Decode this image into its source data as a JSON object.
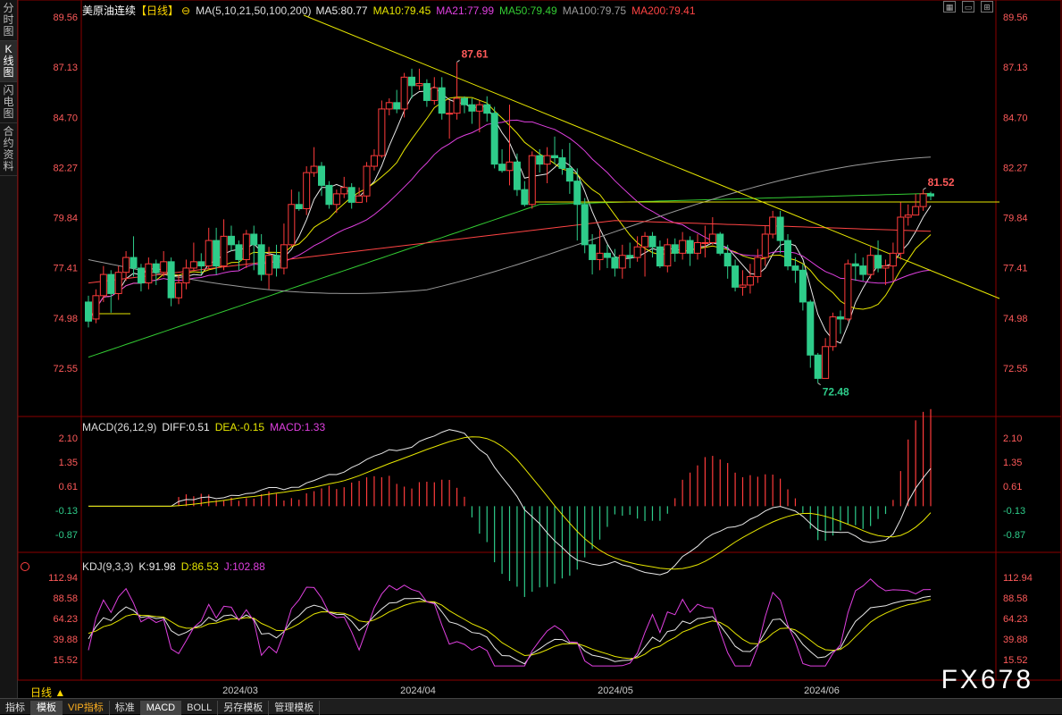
{
  "side_tabs": [
    {
      "label": "分时图",
      "active": false
    },
    {
      "label": "K线图",
      "active": true
    },
    {
      "label": "闪电图",
      "active": false
    },
    {
      "label": "合约资料",
      "active": false
    }
  ],
  "header": {
    "symbol": "美原油连续",
    "period": "【日线】",
    "ma_params": "MA(5,10,21,50,100,200)",
    "ma_items": [
      {
        "text": "MA5:80.77",
        "color": "#e8e8e8"
      },
      {
        "text": "MA10:79.45",
        "color": "#e6e600"
      },
      {
        "text": "MA21:77.99",
        "color": "#e040e0"
      },
      {
        "text": "MA50:79.49",
        "color": "#33cc33"
      },
      {
        "text": "MA100:79.75",
        "color": "#9a9a9a"
      },
      {
        "text": "MA200:79.41",
        "color": "#ff4444"
      }
    ]
  },
  "macd_header": {
    "params": "MACD(26,12,9)",
    "diff": "DIFF:0.51",
    "dea": "DEA:-0.15",
    "macd": "MACD:1.33"
  },
  "kdj_header": {
    "params": "KDJ(9,3,3)",
    "k": "K:91.98",
    "d": "D:86.53",
    "j": "J:102.88"
  },
  "price_axis": [
    "89.56",
    "87.13",
    "84.70",
    "82.27",
    "79.84",
    "77.41",
    "74.98",
    "72.55"
  ],
  "macd_axis": [
    "2.10",
    "1.35",
    "0.61",
    "-0.13",
    "-0.87"
  ],
  "kdj_axis": [
    "112.94",
    "88.58",
    "64.23",
    "39.88",
    "15.52"
  ],
  "date_axis": [
    "2024/03",
    "2024/04",
    "2024/05",
    "2024/06"
  ],
  "annotations": {
    "high": "87.61",
    "low": "72.48",
    "last": "81.52"
  },
  "period_button": "日线 ▲",
  "footer_tabs": [
    {
      "label": "指标",
      "active": false
    },
    {
      "label": "模板",
      "active": true
    },
    {
      "label": "VIP指标",
      "active": false
    },
    {
      "label": "标准",
      "active": false
    },
    {
      "label": "MACD",
      "active": true
    },
    {
      "label": "BOLL",
      "active": false
    },
    {
      "label": "另存模板",
      "active": false
    },
    {
      "label": "管理模板",
      "active": false
    }
  ],
  "watermark": "FX678",
  "colors": {
    "up": "#ff3b3b",
    "down": "#2ecc8a",
    "text_up": "#ff5a5a",
    "text_down": "#2ecc8a",
    "grid": "#1a1a1a"
  },
  "chart_data": {
    "type": "candlestick",
    "ylim": [
      72.0,
      90.2
    ],
    "candles": [
      [
        76.3,
        75.4,
        76.6,
        75.1
      ],
      [
        75.5,
        76.6,
        76.9,
        75.3
      ],
      [
        76.6,
        77.6,
        78.0,
        76.3
      ],
      [
        77.6,
        76.7,
        77.8,
        75.8
      ],
      [
        76.7,
        77.7,
        78.0,
        76.4
      ],
      [
        77.7,
        78.4,
        78.7,
        77.3
      ],
      [
        78.4,
        77.9,
        79.4,
        77.5
      ],
      [
        77.9,
        77.2,
        78.1,
        76.8
      ],
      [
        77.2,
        78.1,
        78.4,
        76.9
      ],
      [
        78.1,
        77.7,
        78.3,
        77.1
      ],
      [
        77.7,
        78.2,
        78.7,
        77.5
      ],
      [
        78.2,
        76.5,
        78.4,
        76.1
      ],
      [
        76.5,
        77.2,
        77.6,
        76.2
      ],
      [
        77.2,
        77.9,
        78.3,
        76.9
      ],
      [
        77.9,
        78.2,
        79.1,
        77.8
      ],
      [
        78.2,
        78.0,
        78.6,
        77.6
      ],
      [
        78.0,
        79.2,
        79.8,
        77.9
      ],
      [
        79.2,
        78.0,
        79.8,
        77.6
      ],
      [
        78.0,
        79.4,
        80.2,
        77.8
      ],
      [
        79.4,
        79.0,
        79.9,
        78.7
      ],
      [
        79.0,
        78.3,
        79.2,
        77.8
      ],
      [
        78.3,
        79.5,
        79.7,
        77.9
      ],
      [
        79.5,
        79.0,
        79.9,
        77.8
      ],
      [
        79.0,
        77.6,
        79.5,
        77.3
      ],
      [
        77.6,
        78.5,
        78.9,
        76.9
      ],
      [
        78.5,
        77.9,
        79.0,
        77.5
      ],
      [
        77.9,
        79.0,
        80.0,
        77.6
      ],
      [
        79.0,
        80.9,
        81.6,
        78.9
      ],
      [
        80.9,
        80.7,
        81.5,
        80.6
      ],
      [
        80.7,
        82.4,
        82.7,
        80.4
      ],
      [
        82.4,
        82.7,
        83.6,
        82.2
      ],
      [
        82.7,
        81.8,
        82.9,
        81.3
      ],
      [
        81.8,
        80.9,
        82.0,
        80.7
      ],
      [
        80.9,
        81.4,
        81.6,
        80.5
      ],
      [
        81.4,
        81.7,
        82.2,
        81.2
      ],
      [
        81.7,
        81.0,
        81.9,
        80.7
      ],
      [
        81.0,
        81.3,
        81.7,
        81.0
      ],
      [
        81.3,
        82.7,
        82.9,
        81.0
      ],
      [
        82.7,
        83.2,
        83.5,
        82.5
      ],
      [
        83.2,
        85.4,
        85.8,
        83.1
      ],
      [
        85.4,
        85.7,
        85.9,
        85.1
      ],
      [
        85.7,
        85.4,
        86.3,
        85.2
      ],
      [
        85.4,
        86.9,
        87.1,
        85.0
      ],
      [
        86.9,
        86.5,
        87.3,
        85.9
      ],
      [
        86.5,
        86.6,
        87.3,
        86.3
      ],
      [
        86.6,
        85.8,
        86.8,
        85.5
      ],
      [
        85.8,
        86.4,
        86.9,
        85.6
      ],
      [
        86.4,
        85.2,
        86.9,
        84.9
      ],
      [
        85.2,
        85.2,
        85.8,
        84.0
      ],
      [
        85.2,
        85.9,
        87.6,
        84.9
      ],
      [
        85.9,
        85.6,
        86.0,
        85.2
      ],
      [
        85.6,
        85.3,
        85.9,
        84.7
      ],
      [
        85.3,
        85.6,
        85.8,
        84.3
      ],
      [
        85.6,
        85.2,
        86.0,
        84.8
      ],
      [
        85.2,
        82.8,
        85.5,
        82.6
      ],
      [
        82.8,
        82.5,
        83.5,
        82.4
      ],
      [
        82.5,
        82.9,
        85.6,
        81.8
      ],
      [
        82.9,
        81.6,
        83.3,
        81.3
      ],
      [
        81.6,
        80.9,
        82.0,
        80.8
      ],
      [
        80.9,
        83.2,
        83.4,
        80.7
      ],
      [
        83.2,
        82.8,
        83.5,
        82.4
      ],
      [
        82.8,
        83.2,
        83.6,
        81.9
      ],
      [
        83.2,
        83.1,
        84.1,
        82.8
      ],
      [
        83.1,
        82.6,
        83.5,
        82.3
      ],
      [
        82.6,
        82.0,
        83.8,
        81.4
      ],
      [
        82.0,
        80.9,
        82.6,
        79.2
      ],
      [
        80.9,
        79.0,
        81.2,
        78.6
      ],
      [
        79.0,
        78.3,
        79.5,
        77.6
      ],
      [
        78.3,
        78.6,
        79.7,
        77.8
      ],
      [
        78.6,
        78.4,
        79.0,
        77.9
      ],
      [
        78.4,
        77.9,
        78.8,
        77.5
      ],
      [
        77.9,
        78.5,
        79.0,
        77.4
      ],
      [
        78.5,
        78.4,
        79.1,
        77.9
      ],
      [
        78.4,
        78.9,
        79.4,
        78.2
      ],
      [
        78.9,
        79.4,
        79.6,
        77.5
      ],
      [
        79.4,
        78.9,
        79.6,
        78.4
      ],
      [
        78.9,
        78.0,
        79.2,
        77.9
      ],
      [
        78.0,
        79.0,
        79.3,
        77.7
      ],
      [
        79.0,
        78.6,
        79.3,
        78.2
      ],
      [
        78.6,
        79.2,
        79.6,
        78.3
      ],
      [
        79.2,
        78.6,
        79.4,
        78.0
      ],
      [
        78.6,
        79.1,
        79.5,
        78.3
      ],
      [
        79.1,
        79.1,
        79.9,
        78.4
      ],
      [
        79.1,
        79.5,
        80.3,
        79.0
      ],
      [
        79.5,
        78.6,
        79.6,
        78.5
      ],
      [
        78.6,
        78.0,
        79.0,
        77.4
      ],
      [
        78.0,
        77.0,
        78.3,
        76.8
      ],
      [
        77.0,
        77.1,
        77.8,
        76.6
      ],
      [
        77.1,
        77.5,
        78.1,
        76.7
      ],
      [
        77.5,
        78.4,
        78.8,
        77.2
      ],
      [
        78.4,
        79.5,
        79.9,
        78.0
      ],
      [
        79.5,
        80.3,
        80.6,
        79.3
      ],
      [
        80.3,
        79.2,
        80.6,
        78.6
      ],
      [
        79.2,
        78.0,
        79.5,
        77.8
      ],
      [
        78.0,
        77.8,
        78.4,
        77.2
      ],
      [
        77.8,
        76.3,
        78.1,
        75.9
      ],
      [
        76.3,
        73.8,
        76.4,
        73.2
      ],
      [
        73.8,
        72.7,
        73.9,
        72.48
      ],
      [
        72.7,
        74.2,
        74.6,
        72.7
      ],
      [
        74.2,
        75.6,
        75.8,
        74.0
      ],
      [
        75.6,
        75.5,
        75.9,
        74.8
      ],
      [
        75.5,
        78.1,
        78.3,
        75.4
      ],
      [
        78.1,
        78.0,
        78.6,
        77.3
      ],
      [
        78.0,
        77.6,
        78.4,
        77.3
      ],
      [
        77.6,
        78.5,
        78.9,
        77.4
      ],
      [
        78.5,
        77.9,
        79.2,
        77.7
      ],
      [
        77.9,
        78.0,
        78.3,
        77.1
      ],
      [
        78.0,
        78.6,
        79.1,
        77.3
      ],
      [
        78.6,
        80.3,
        81.0,
        78.3
      ],
      [
        80.3,
        80.4,
        80.9,
        79.9
      ],
      [
        80.4,
        80.8,
        81.4,
        80.4
      ],
      [
        80.8,
        81.4,
        81.6,
        80.6
      ],
      [
        81.4,
        81.3,
        81.5,
        81.1
      ]
    ]
  }
}
